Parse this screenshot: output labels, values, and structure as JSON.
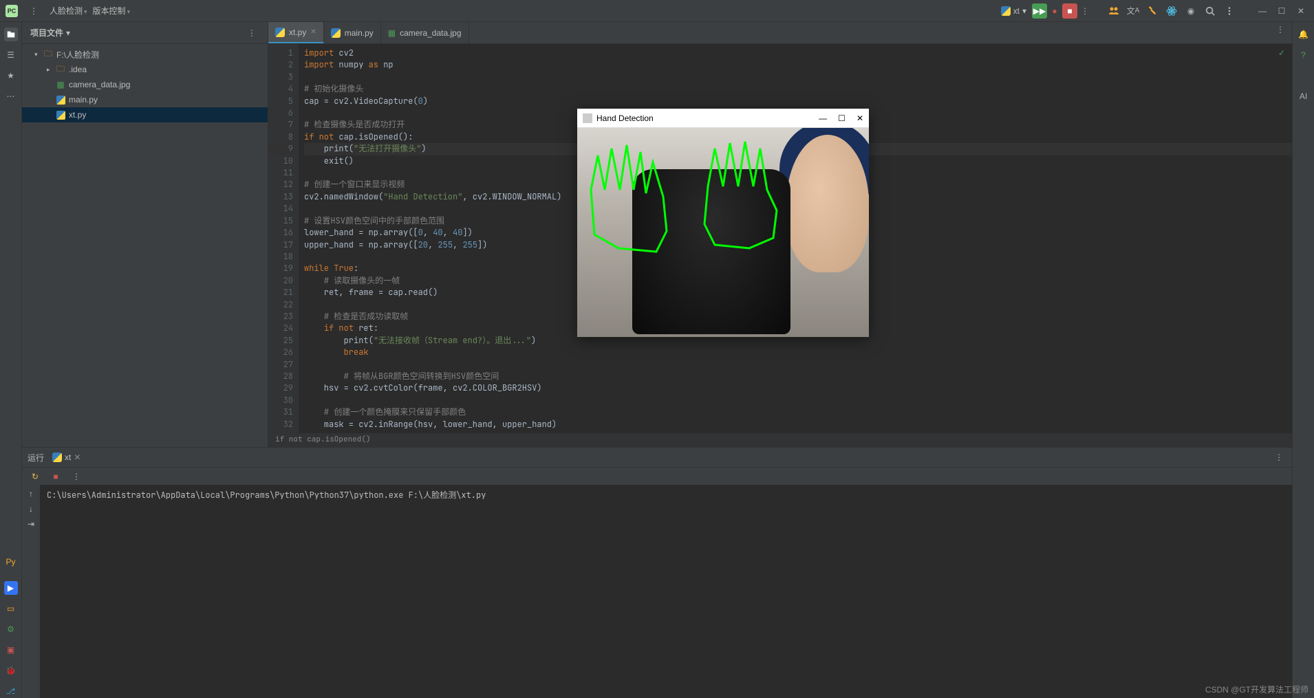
{
  "topbar": {
    "menu_icon": "⋮",
    "breadcrumb1": "人脸检测",
    "breadcrumb2": "版本控制",
    "run_config": "xt",
    "icons": {
      "collaborators": "collaborators-icon",
      "translate": "translate-icon",
      "hammer": "hammer-icon",
      "atom": "atom-icon",
      "circle": "circle-icon",
      "search": "search-icon",
      "more": "more-icon",
      "minimize": "minimize-icon",
      "maximize": "maximize-icon",
      "close": "close-icon"
    }
  },
  "leftrail": [
    "project",
    "structure",
    "bookmarks",
    "more",
    "python",
    "run-tool",
    "database",
    "terminal",
    "todo",
    "vcs"
  ],
  "rightrail": [
    "notifications",
    "help",
    "ai"
  ],
  "project": {
    "title": "项目文件",
    "root": "F:\\人脸检测",
    "nodes": [
      {
        "indent": 1,
        "arr": "▾",
        "icon": "folder",
        "label": "F:\\人脸检测"
      },
      {
        "indent": 2,
        "arr": "▸",
        "icon": "folder",
        "label": ".idea"
      },
      {
        "indent": 2,
        "arr": "",
        "icon": "img",
        "label": "camera_data.jpg"
      },
      {
        "indent": 2,
        "arr": "",
        "icon": "py",
        "label": "main.py"
      },
      {
        "indent": 2,
        "arr": "",
        "icon": "py",
        "label": "xt.py",
        "sel": true
      }
    ]
  },
  "editor": {
    "tabs": [
      {
        "icon": "py",
        "label": "xt.py",
        "active": true,
        "close": true
      },
      {
        "icon": "py",
        "label": "main.py",
        "active": false,
        "close": false
      },
      {
        "icon": "img",
        "label": "camera_data.jpg",
        "active": false,
        "close": false
      }
    ],
    "breadcrumb": "if not cap.isOpened()",
    "current_line": 9,
    "lines": [
      {
        "n": 1,
        "html": "<span class='k'>import</span> cv2"
      },
      {
        "n": 2,
        "html": "<span class='k'>import</span> numpy <span class='k'>as</span> np"
      },
      {
        "n": 3,
        "html": ""
      },
      {
        "n": 4,
        "html": "<span class='c'># 初始化摄像头</span>"
      },
      {
        "n": 5,
        "html": "cap = cv2.VideoCapture(<span class='n'>0</span>)"
      },
      {
        "n": 6,
        "html": ""
      },
      {
        "n": 7,
        "html": "<span class='c'># 检查摄像头是否成功打开</span>"
      },
      {
        "n": 8,
        "html": "<span class='k'>if not</span> cap.isOpened():"
      },
      {
        "n": 9,
        "html": "    print(<span class='s'>\"无法打开摄像头\"</span>)"
      },
      {
        "n": 10,
        "html": "    exit()"
      },
      {
        "n": 11,
        "html": ""
      },
      {
        "n": 12,
        "html": "<span class='c'># 创建一个窗口来显示视频</span>"
      },
      {
        "n": 13,
        "html": "cv2.namedWindow(<span class='s'>\"Hand Detection\"</span>, cv2.WINDOW_NORMAL)"
      },
      {
        "n": 14,
        "html": ""
      },
      {
        "n": 15,
        "html": "<span class='c'># 设置HSV颜色空间中的手部颜色范围</span>"
      },
      {
        "n": 16,
        "html": "lower_hand = np.array([<span class='n'>0</span>, <span class='n'>40</span>, <span class='n'>40</span>])"
      },
      {
        "n": 17,
        "html": "upper_hand = np.array([<span class='n'>20</span>, <span class='n'>255</span>, <span class='n'>255</span>])"
      },
      {
        "n": 18,
        "html": ""
      },
      {
        "n": 19,
        "html": "<span class='k'>while True</span>:"
      },
      {
        "n": 20,
        "html": "    <span class='c'># 读取摄像头的一帧</span>"
      },
      {
        "n": 21,
        "html": "    ret, frame = cap.read()"
      },
      {
        "n": 22,
        "html": ""
      },
      {
        "n": 23,
        "html": "    <span class='c'># 检查是否成功读取帧</span>"
      },
      {
        "n": 24,
        "html": "    <span class='k'>if not</span> ret:"
      },
      {
        "n": 25,
        "html": "        print(<span class='s'>\"无法接收帧（Stream end?）。退出...\"</span>)"
      },
      {
        "n": 26,
        "html": "        <span class='k'>break</span>"
      },
      {
        "n": 27,
        "html": ""
      },
      {
        "n": 28,
        "html": "        <span class='c'># 将帧从BGR颜色空间转换到HSV颜色空间</span>"
      },
      {
        "n": 29,
        "html": "    hsv = cv2.cvtColor(frame, cv2.COLOR_BGR2HSV)"
      },
      {
        "n": 30,
        "html": ""
      },
      {
        "n": 31,
        "html": "    <span class='c'># 创建一个颜色掩膜来只保留手部颜色</span>"
      },
      {
        "n": 32,
        "html": "    mask = cv2.inRange(hsv, lower_hand, upper_hand)"
      }
    ]
  },
  "popup": {
    "title": "Hand Detection"
  },
  "run": {
    "tab_label": "运行",
    "config_tab": "xt",
    "output": "C:\\Users\\Administrator\\AppData\\Local\\Programs\\Python\\Python37\\python.exe F:\\人脸检测\\xt.py"
  },
  "watermark": "CSDN @GT开发算法工程师"
}
